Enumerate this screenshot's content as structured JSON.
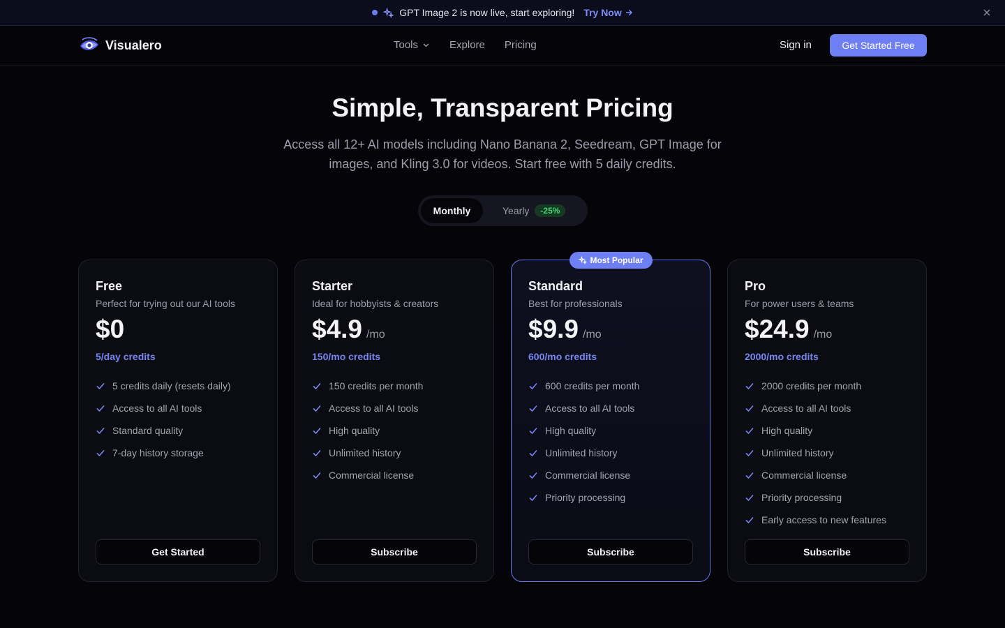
{
  "announcement": {
    "text": "GPT Image 2 is now live, start exploring!",
    "link": "Try Now"
  },
  "nav": {
    "brand": "Visualero",
    "links": [
      "Tools",
      "Explore",
      "Pricing"
    ],
    "sign_in": "Sign in",
    "cta": "Get Started Free"
  },
  "hero": {
    "title": "Simple, Transparent Pricing",
    "subtitle": "Access all 12+ AI models including Nano Banana 2, Seedream, GPT Image for images, and Kling 3.0 for videos. Start free with 5 daily credits."
  },
  "billing_toggle": {
    "monthly": "Monthly",
    "yearly": "Yearly",
    "yearly_discount": "-25%"
  },
  "plans": [
    {
      "name": "Free",
      "description": "Perfect for trying out our AI tools",
      "price": "$0",
      "period": "",
      "credits": "5/day credits",
      "features": [
        "5 credits daily (resets daily)",
        "Access to all AI tools",
        "Standard quality",
        "7-day history storage"
      ],
      "button": "Get Started"
    },
    {
      "name": "Starter",
      "description": "Ideal for hobbyists & creators",
      "price": "$4.9",
      "period": "/mo",
      "credits": "150/mo credits",
      "features": [
        "150 credits per month",
        "Access to all AI tools",
        "High quality",
        "Unlimited history",
        "Commercial license"
      ],
      "button": "Subscribe"
    },
    {
      "name": "Standard",
      "description": "Best for professionals",
      "price": "$9.9",
      "period": "/mo",
      "credits": "600/mo credits",
      "badge": "Most Popular",
      "features": [
        "600 credits per month",
        "Access to all AI tools",
        "High quality",
        "Unlimited history",
        "Commercial license",
        "Priority processing"
      ],
      "button": "Subscribe"
    },
    {
      "name": "Pro",
      "description": "For power users & teams",
      "price": "$24.9",
      "period": "/mo",
      "credits": "2000/mo credits",
      "features": [
        "2000 credits per month",
        "Access to all AI tools",
        "High quality",
        "Unlimited history",
        "Commercial license",
        "Priority processing",
        "Early access to new features"
      ],
      "button": "Subscribe"
    }
  ],
  "colors": {
    "accent": "#6e7ff3",
    "background": "#050509",
    "discount_green": "#47d175"
  }
}
